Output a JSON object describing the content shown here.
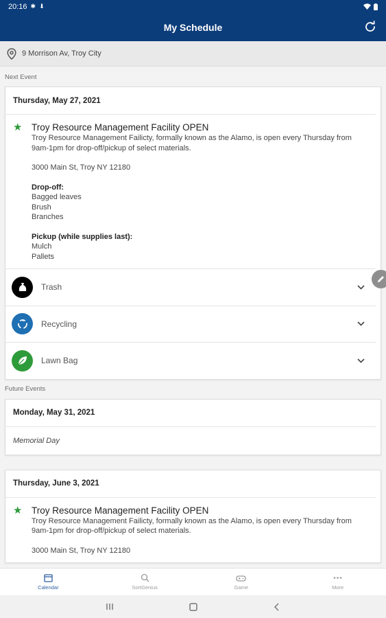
{
  "status_bar": {
    "time": "20:16",
    "icons_left": [
      "app-notification",
      "download"
    ],
    "icons_right": [
      "wifi",
      "battery"
    ]
  },
  "app_bar": {
    "title": "My Schedule",
    "action_icon": "refresh-icon"
  },
  "address": {
    "icon": "location-pin-icon",
    "text": "9 Morrison Av, Troy City"
  },
  "next_event": {
    "section_label": "Next Event",
    "date": "Thursday, May 27, 2021",
    "event": {
      "title": "Troy Resource Management Facility OPEN",
      "description": "Troy Resource Management Failicty, formally known as the Alamo, is open every Thursday from 9am-1pm for drop-off/pickup of select materials.",
      "address": "3000 Main St, Troy NY 12180",
      "dropoff_heading": "Drop-off:",
      "dropoff_items": [
        "Bagged leaves",
        "Brush",
        "Branches"
      ],
      "pickup_heading": "Pickup (while supplies last):",
      "pickup_items": [
        "Mulch",
        "Pallets"
      ]
    },
    "categories": [
      {
        "label": "Trash",
        "icon": "trash-bag-icon",
        "color": "#000000"
      },
      {
        "label": "Recycling",
        "icon": "recycle-icon",
        "color": "#1f6fb3"
      },
      {
        "label": "Lawn Bag",
        "icon": "leaf-icon",
        "color": "#2e9b3a"
      }
    ]
  },
  "future_events": {
    "section_label": "Future Events",
    "cards": [
      {
        "date": "Monday, May 31, 2021",
        "holiday": "Memorial Day"
      },
      {
        "date": "Thursday, June 3, 2021",
        "event": {
          "title": "Troy Resource Management Facility OPEN",
          "description": "Troy Resource Management Failicty, formally known as the Alamo, is open every Thursday from 9am-1pm for drop-off/pickup of select materials.",
          "address": "3000 Main St, Troy NY 12180"
        }
      }
    ]
  },
  "bottom_nav": [
    {
      "label": "Calendar",
      "icon": "calendar-icon",
      "active": true
    },
    {
      "label": "SortGenius",
      "icon": "magnifier-icon",
      "active": false
    },
    {
      "label": "Game",
      "icon": "gamepad-icon",
      "active": false
    },
    {
      "label": "More",
      "icon": "more-dots-icon",
      "active": false
    }
  ],
  "colors": {
    "primary": "#0b3d7a",
    "accent": "#2e9b3a",
    "active_nav": "#2f5fa0"
  }
}
